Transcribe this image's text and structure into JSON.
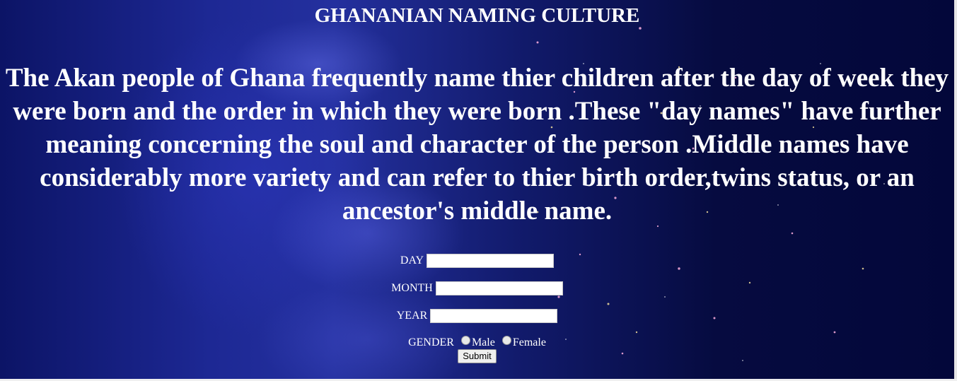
{
  "page": {
    "title": "GHANANIAN NAMING CULTURE",
    "intro": "The Akan people of Ghana frequently name thier children after the day of week they were born and the order in which they were born .These \"day names\" have further meaning concerning the soul and character of the person .Middle names have considerably more variety and can refer to thier birth order,twins status, or an ancestor's middle name."
  },
  "form": {
    "day_label": "DAY",
    "day_value": "",
    "month_label": "MONTH",
    "month_value": "",
    "year_label": "YEAR",
    "year_value": "",
    "gender_label": "GENDER",
    "gender_options": [
      "Male",
      "Female"
    ],
    "submit_label": "Submit"
  },
  "colors": {
    "background_primary": "#0c1466",
    "background_dark": "#03073a",
    "text": "#ffffff"
  }
}
